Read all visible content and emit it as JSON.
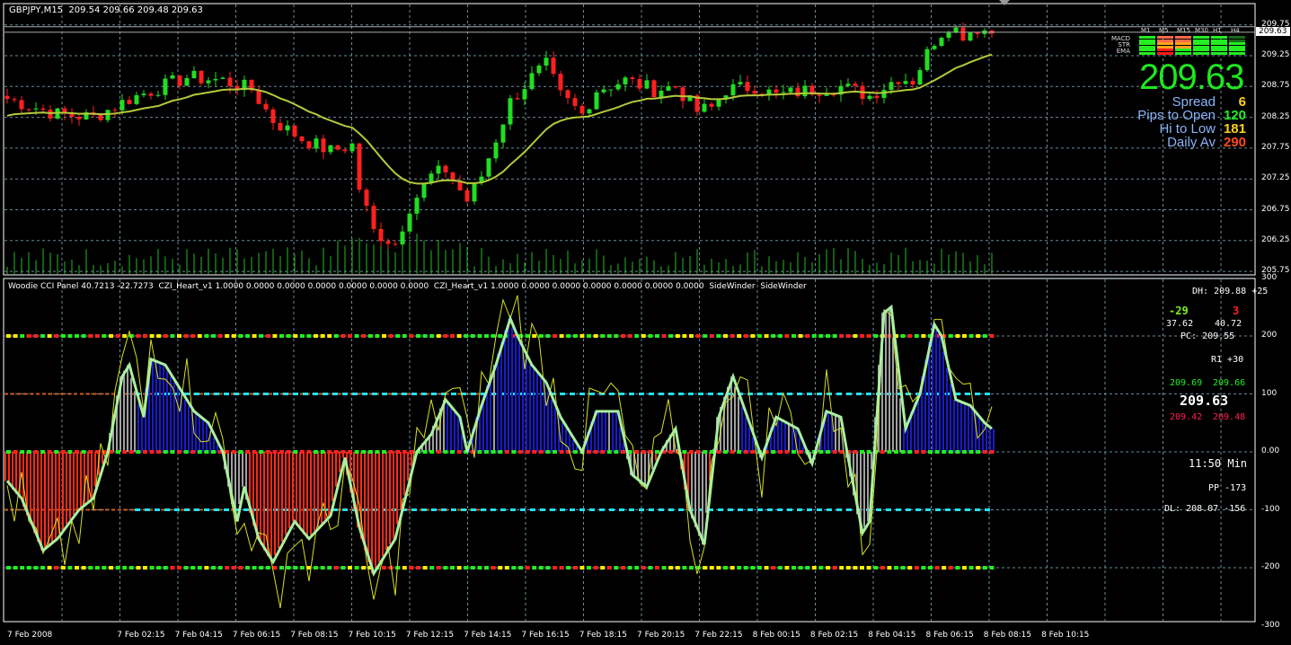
{
  "header": {
    "symbol": "GBPJPY,M15",
    "ohlc": "209.54 209.66 209.48 209.63"
  },
  "indicator_label": {
    "cci": "Woodie CCI Panel 40.7213 -22.7273",
    "czi1": "CZI_Heart_v1 1.0000 0.0000 0.0000 0.0000 0.0000 0.0000 0.0000",
    "czi2": "CZI_Heart_v1 1.0000 0.0000 0.0000 0.0000 0.0000 0.0000 0.0000",
    "sw1": "SideWinder",
    "sw2": "SideWinder"
  },
  "panel": {
    "timeframes": [
      "M1",
      "M5",
      "M15",
      "M30",
      "H1",
      "H4"
    ],
    "rows": [
      "MACD",
      "STR",
      "EMA"
    ],
    "leds": [
      [
        "#22ee22",
        "#ff6a4a",
        "#ff6a4a",
        "#22ee22",
        "#22ee22",
        "#1a6a1a"
      ],
      [
        "#22ee22",
        "#ffa31a",
        "#ffa31a",
        "#22ee22",
        "#22ee22",
        "#22ee22"
      ],
      [
        "#22ee22",
        "#ff1a1a",
        "#22ee22",
        "#22ee22",
        "#22ee22",
        "#22ee22"
      ]
    ],
    "price": "209.63",
    "stats": [
      {
        "label": "Spread",
        "value": "6",
        "color": "#ffd21a"
      },
      {
        "label": "Pips to Open",
        "value": "120",
        "color": "#22ee22"
      },
      {
        "label": "Hi to Low",
        "value": "181",
        "color": "#ffd21a"
      },
      {
        "label": "Daily Av",
        "value": "290",
        "color": "#ff4a1a"
      }
    ]
  },
  "cci_panel": {
    "dh": "DH: 209.88 +25",
    "left_num": "-29",
    "right_num": "3",
    "left_val": "37.62",
    "right_val": "40.72",
    "pc": "PC: 209.55",
    "r1": "R1 +30",
    "g1": "209.69",
    "g2": "209.66",
    "price": "209.63",
    "r_1": "209.42",
    "r_2": "209.48",
    "timer": "11:50 Min",
    "pp": "PP -173",
    "dl": "DL: 208.07 -156"
  },
  "price_axis": [
    "209.75",
    "209.25",
    "208.75",
    "208.25",
    "207.75",
    "207.25",
    "206.75",
    "206.25",
    "205.75"
  ],
  "current_price_tag": "209.63",
  "cci_axis": [
    "300",
    "200",
    "100",
    "0.00",
    "-100",
    "-200",
    "-300"
  ],
  "time_axis": [
    "7 Feb 2008",
    "7 Feb 02:15",
    "7 Feb 04:15",
    "7 Feb 06:15",
    "7 Feb 08:15",
    "7 Feb 10:15",
    "7 Feb 12:15",
    "7 Feb 14:15",
    "7 Feb 16:15",
    "7 Feb 18:15",
    "7 Feb 20:15",
    "7 Feb 22:15",
    "8 Feb 00:15",
    "8 Feb 02:15",
    "8 Feb 04:15",
    "8 Feb 06:15",
    "8 Feb 08:15",
    "8 Feb 10:15"
  ],
  "chart_data": {
    "type": "candlestick",
    "bars": 138,
    "close_keypoints": [
      [
        0,
        208.55
      ],
      [
        7,
        208.3
      ],
      [
        12,
        208.25
      ],
      [
        17,
        208.55
      ],
      [
        25,
        208.9
      ],
      [
        30,
        208.85
      ],
      [
        34,
        208.7
      ],
      [
        37,
        208.2
      ],
      [
        41,
        207.9
      ],
      [
        45,
        207.7
      ],
      [
        48,
        207.8
      ],
      [
        49,
        207.1
      ],
      [
        51,
        206.4
      ],
      [
        54,
        206.2
      ],
      [
        56,
        206.8
      ],
      [
        59,
        207.3
      ],
      [
        61,
        207.4
      ],
      [
        64,
        206.9
      ],
      [
        66,
        207.3
      ],
      [
        70,
        208.5
      ],
      [
        73,
        208.9
      ],
      [
        75,
        209.1
      ],
      [
        77,
        208.6
      ],
      [
        80,
        208.3
      ],
      [
        82,
        208.7
      ],
      [
        86,
        208.85
      ],
      [
        90,
        208.7
      ],
      [
        93,
        208.75
      ],
      [
        96,
        208.35
      ],
      [
        98,
        208.4
      ],
      [
        100,
        208.7
      ],
      [
        104,
        208.75
      ],
      [
        107,
        208.6
      ],
      [
        112,
        208.7
      ],
      [
        116,
        208.75
      ],
      [
        120,
        208.6
      ],
      [
        124,
        208.9
      ],
      [
        126,
        208.85
      ],
      [
        129,
        209.5
      ],
      [
        131,
        209.75
      ],
      [
        133,
        209.6
      ],
      [
        135,
        209.7
      ],
      [
        137,
        209.63
      ]
    ],
    "cci_keypoints": [
      [
        0,
        -50
      ],
      [
        2,
        -80
      ],
      [
        5,
        -170
      ],
      [
        7,
        -150
      ],
      [
        10,
        -100
      ],
      [
        12,
        -80
      ],
      [
        14,
        0
      ],
      [
        16,
        130
      ],
      [
        17,
        150
      ],
      [
        19,
        60
      ],
      [
        20,
        160
      ],
      [
        22,
        150
      ],
      [
        24,
        110
      ],
      [
        26,
        70
      ],
      [
        28,
        50
      ],
      [
        30,
        0
      ],
      [
        32,
        -120
      ],
      [
        33,
        -60
      ],
      [
        35,
        -150
      ],
      [
        37,
        -190
      ],
      [
        40,
        -120
      ],
      [
        42,
        -150
      ],
      [
        45,
        -110
      ],
      [
        47,
        -10
      ],
      [
        49,
        -130
      ],
      [
        51,
        -210
      ],
      [
        54,
        -150
      ],
      [
        57,
        0
      ],
      [
        59,
        30
      ],
      [
        61,
        90
      ],
      [
        63,
        60
      ],
      [
        64,
        0
      ],
      [
        66,
        80
      ],
      [
        68,
        150
      ],
      [
        70,
        230
      ],
      [
        71,
        200
      ],
      [
        73,
        150
      ],
      [
        75,
        120
      ],
      [
        77,
        60
      ],
      [
        80,
        0
      ],
      [
        82,
        70
      ],
      [
        85,
        70
      ],
      [
        87,
        -40
      ],
      [
        89,
        -60
      ],
      [
        91,
        0
      ],
      [
        93,
        40
      ],
      [
        95,
        -100
      ],
      [
        97,
        -160
      ],
      [
        99,
        60
      ],
      [
        101,
        130
      ],
      [
        103,
        60
      ],
      [
        105,
        -10
      ],
      [
        107,
        60
      ],
      [
        110,
        40
      ],
      [
        112,
        -20
      ],
      [
        114,
        70
      ],
      [
        116,
        60
      ],
      [
        117,
        -10
      ],
      [
        119,
        -140
      ],
      [
        120,
        -120
      ],
      [
        122,
        240
      ],
      [
        123,
        250
      ],
      [
        125,
        40
      ],
      [
        127,
        100
      ],
      [
        129,
        220
      ],
      [
        130,
        200
      ],
      [
        132,
        90
      ],
      [
        134,
        80
      ],
      [
        136,
        50
      ],
      [
        137,
        40
      ]
    ],
    "price_range": [
      205.7,
      209.85
    ],
    "cci_range": [
      -300,
      300
    ],
    "ema_period": 20,
    "colors": {
      "up": "#22dd22",
      "down": "#ff2020",
      "ema": "#b5c93a",
      "cci": "#a8f0a0",
      "hist_pos": "#1a1ad0",
      "hist_neg": "#ff2a1a",
      "hist_mid": "#a0a0a0"
    }
  }
}
